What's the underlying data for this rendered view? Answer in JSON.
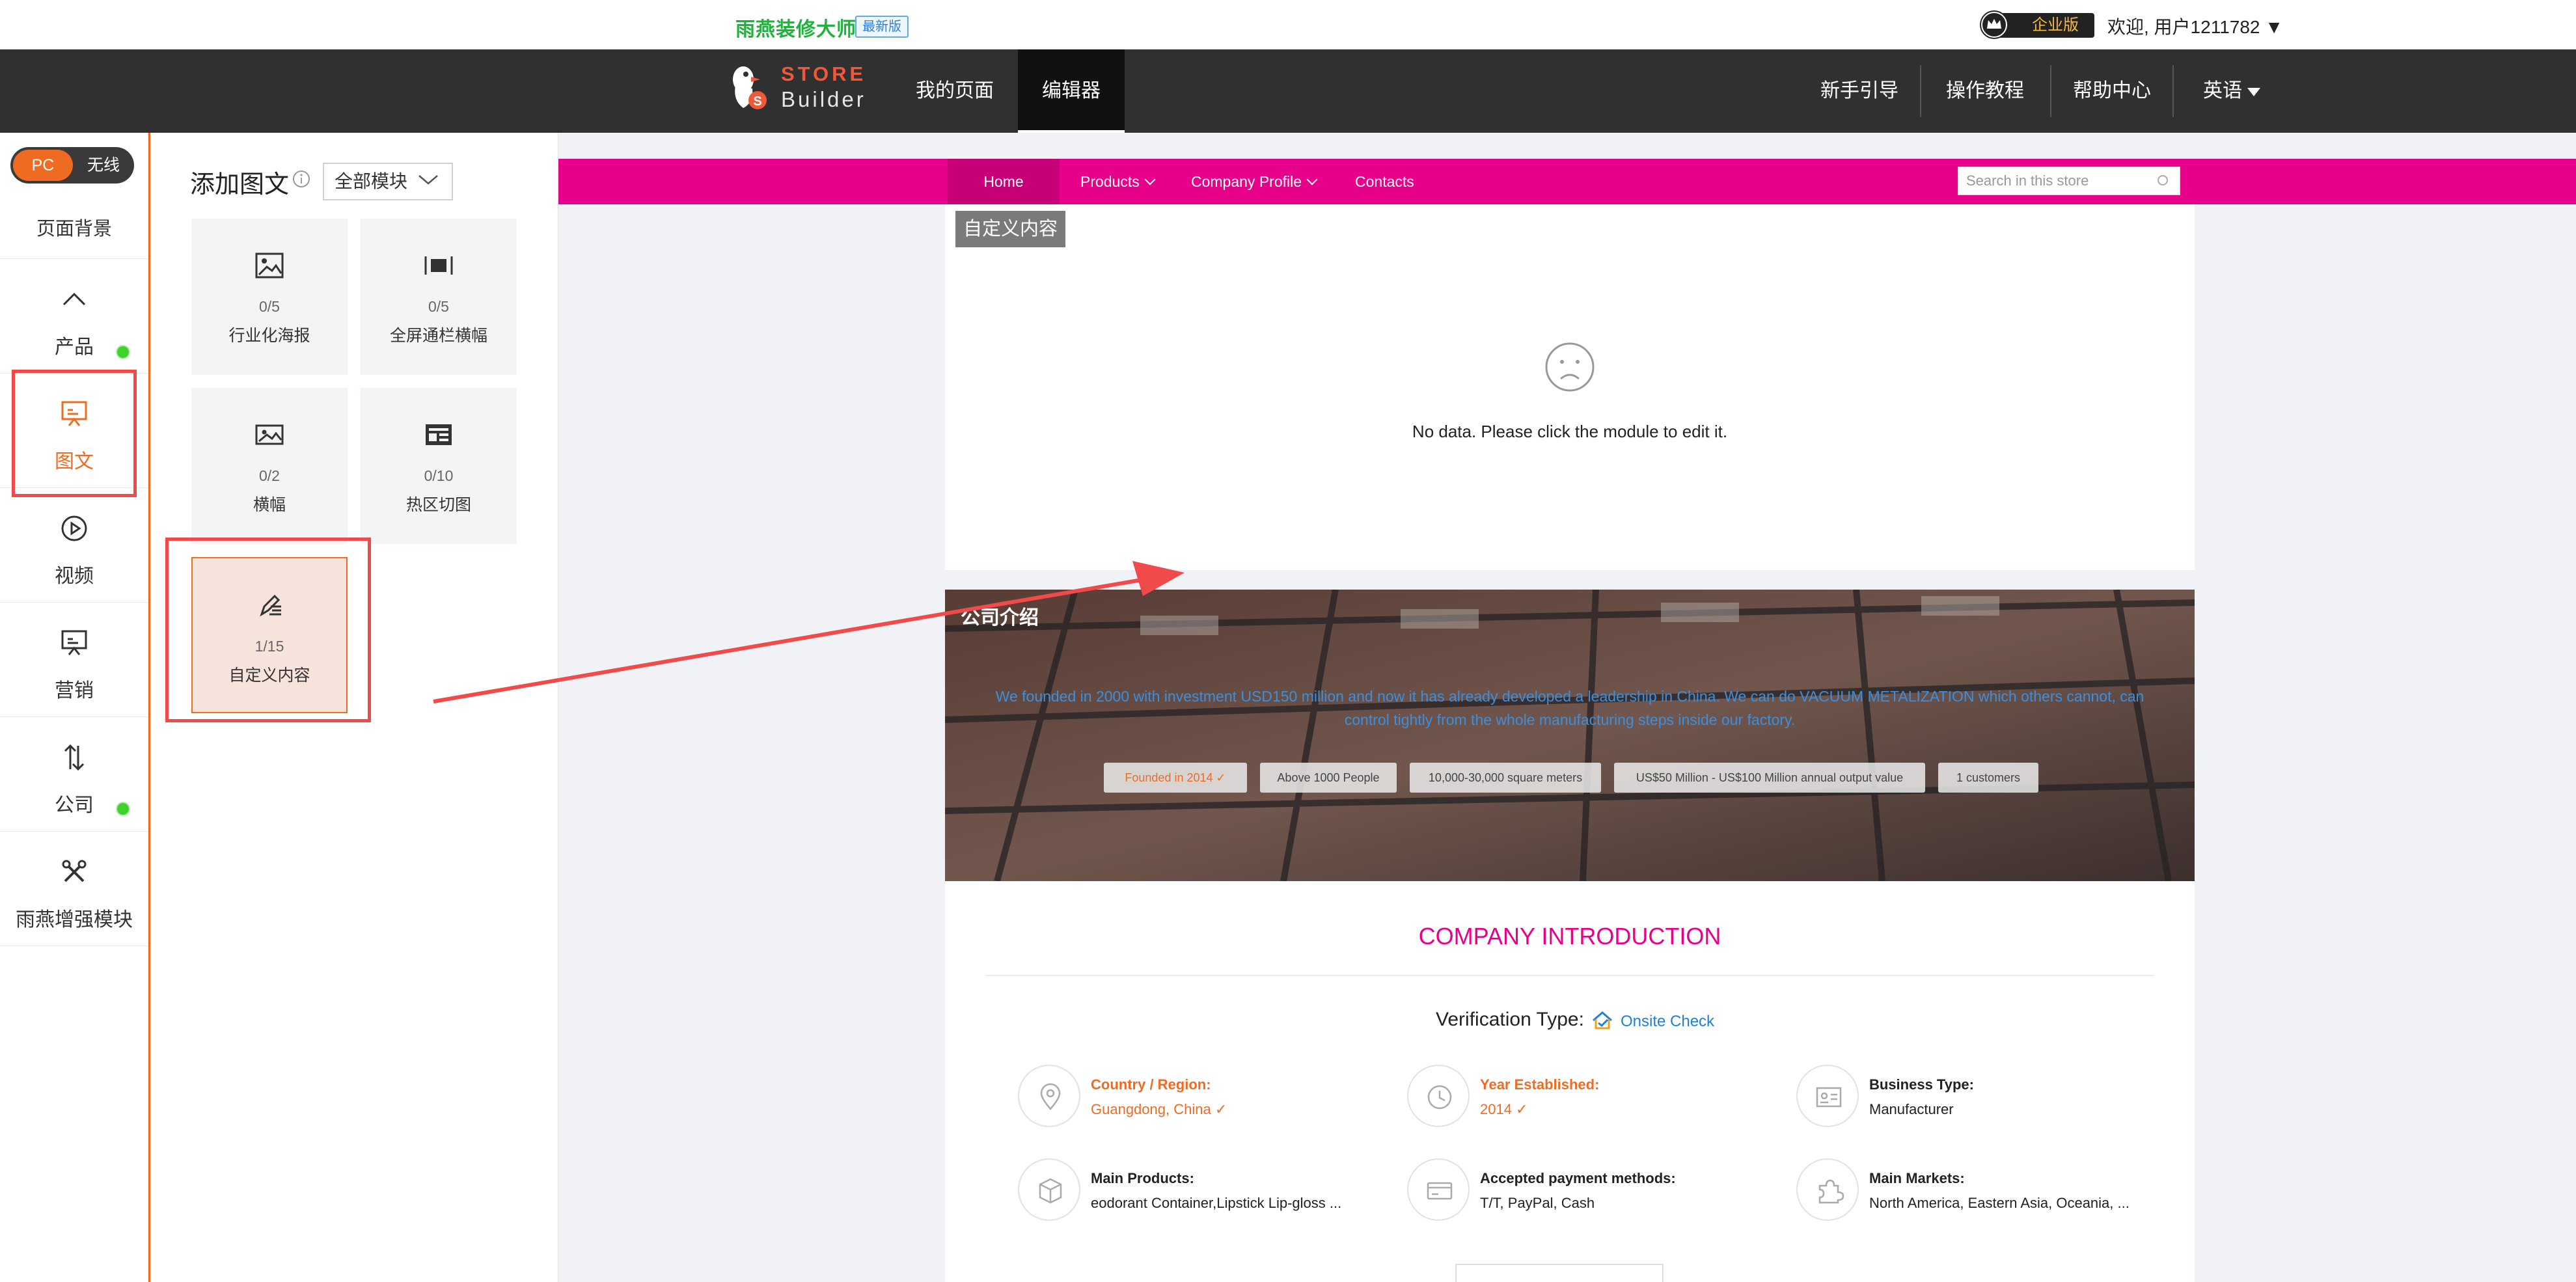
{
  "topbar": {
    "brand_cn": "雨燕装修大师",
    "brand_badge": "最新版",
    "enterprise_badge": "企业版",
    "welcome": "欢迎, 用户1211782 ▼"
  },
  "navbar": {
    "logo_store": "STORE",
    "logo_builder": "Builder",
    "items": [
      "我的页面",
      "编辑器"
    ],
    "right_items": [
      "新手引导",
      "操作教程",
      "帮助中心",
      "英语"
    ]
  },
  "sidebar": {
    "toggle_on": "PC",
    "toggle_off": "无线",
    "bg_item": "页面背景",
    "items": [
      {
        "label": "产品",
        "icon": "chevron-up-icon"
      },
      {
        "label": "图文",
        "icon": "slideshow-icon"
      },
      {
        "label": "视频",
        "icon": "play-circle-icon"
      },
      {
        "label": "营销",
        "icon": "presentation-icon"
      },
      {
        "label": "公司",
        "icon": "sort-arrows-icon"
      },
      {
        "label": "雨燕增强模块",
        "icon": "tools-icon"
      }
    ]
  },
  "panel": {
    "title": "添加图文",
    "filter_value": "全部模块",
    "modules": [
      {
        "count": "0/5",
        "name": "行业化海报",
        "icon": "image-icon"
      },
      {
        "count": "0/5",
        "name": "全屏通栏横幅",
        "icon": "fullscreen-banner-icon"
      },
      {
        "count": "0/2",
        "name": "横幅",
        "icon": "banner-image-icon"
      },
      {
        "count": "0/10",
        "name": "热区切图",
        "icon": "hotspot-grid-icon"
      },
      {
        "count": "1/15",
        "name": "自定义内容",
        "icon": "pen-edit-icon"
      }
    ]
  },
  "store": {
    "nav": {
      "home": "Home",
      "products": "Products",
      "company": "Company Profile",
      "contacts": "Contacts",
      "search_placeholder": "Search in this store"
    },
    "custom_label": "自定义内容",
    "no_data": "No data. Please click the module to edit it.",
    "hero": {
      "label": "公司介绍",
      "text": "We founded in 2000 with investment USD150 million and now it has already developed a leadership in China. We can do VACUUM METALIZATION which others cannot, can control tightly from the whole manufacturing steps inside our factory.",
      "pills": [
        "Founded in 2014 ✓",
        "Above 1000 People",
        "10,000-30,000 square meters",
        "US$50 Million - US$100 Million annual output value",
        "1 customers"
      ]
    },
    "intro": {
      "title": "COMPANY INTRODUCTION",
      "verify_label": "Verification Type:",
      "verify_link": "Onsite Check",
      "facts": [
        {
          "key": "Country / Region:",
          "value": "Guangdong, China ✓",
          "icon": "location-pin-icon"
        },
        {
          "key": "Year Established:",
          "value": "2014 ✓",
          "icon": "history-clock-icon"
        },
        {
          "key": "Business Type:",
          "value": "Manufacturer",
          "icon": "id-card-icon"
        },
        {
          "key": "Main Products:",
          "value": "eodorant Container,Lipstick Lip-gloss ...",
          "icon": "box-icon"
        },
        {
          "key": "Accepted payment methods:",
          "value": "T/T, PayPal, Cash",
          "icon": "credit-card-icon"
        },
        {
          "key": "Main Markets:",
          "value": "North America, Eastern Asia, Oceania, ...",
          "icon": "puzzle-icon"
        }
      ]
    }
  },
  "colors": {
    "accent": "#f06b22",
    "store_nav": "#e7008a",
    "highlight": "#f04a4a"
  }
}
